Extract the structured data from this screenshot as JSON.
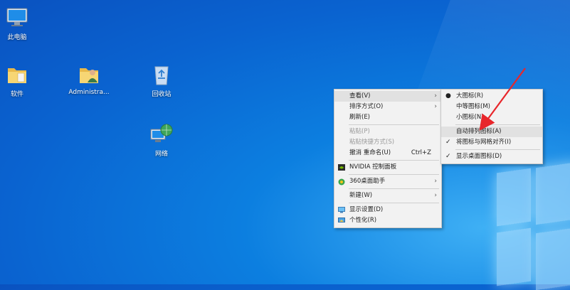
{
  "desktop_icons": [
    {
      "label": "此电脑"
    },
    {
      "label": "软件"
    },
    {
      "label": "Administra..."
    },
    {
      "label": "回收站"
    },
    {
      "label": "网络"
    }
  ],
  "context_menu": {
    "view": "查看(V)",
    "sort": "排序方式(O)",
    "refresh": "刷新(E)",
    "paste": "粘贴(P)",
    "paste_shortcut": "粘贴快捷方式(S)",
    "undo_rename": "撤消 重命名(U)",
    "undo_shortcut": "Ctrl+Z",
    "nvidia": "NVIDIA 控制面板",
    "helper360": "360桌面助手",
    "new": "新建(W)",
    "display": "显示设置(D)",
    "personalize": "个性化(R)"
  },
  "view_submenu": {
    "large": "大图标(R)",
    "medium": "中等图标(M)",
    "small": "小图标(N)",
    "auto_arrange": "自动排列图标(A)",
    "align_grid": "将图标与网格对齐(I)",
    "show_icons": "显示桌面图标(D)"
  },
  "colors": {
    "annotation_arrow": "#e8262b",
    "menu_bg": "#f2f2f2"
  }
}
